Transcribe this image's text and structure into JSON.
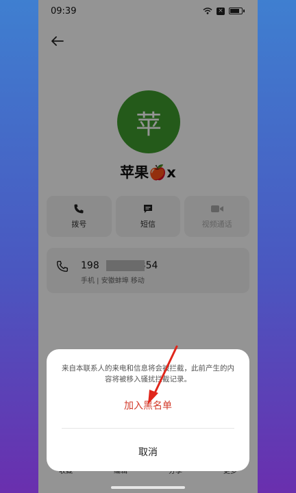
{
  "status_bar": {
    "time": "09:39",
    "sim_badge": "×"
  },
  "contact": {
    "avatar_char": "苹",
    "name": "苹果🍎x",
    "avatar_color": "#3e9b2d"
  },
  "actions": [
    {
      "label": "拨号",
      "icon": "phone-icon"
    },
    {
      "label": "短信",
      "icon": "message-icon"
    },
    {
      "label": "视频通话",
      "icon": "video-icon"
    }
  ],
  "number": {
    "prefix": "198",
    "suffix": "354",
    "detail": "手机 | 安徽蚌埠 移动"
  },
  "sheet": {
    "message": "来自本联系人的来电和信息将会被拦截，此前产生的内容将被移入骚扰拦截记录。",
    "confirm_label": "加入黑名单",
    "cancel_label": "取消",
    "accent": "#d23a2a"
  },
  "bottom_bar": [
    "收藏",
    "编辑",
    "分享",
    "更多"
  ]
}
